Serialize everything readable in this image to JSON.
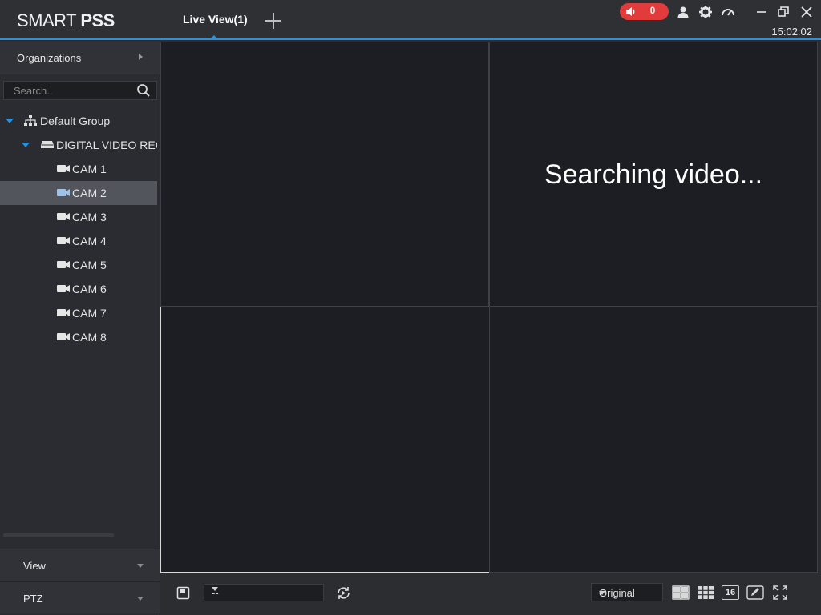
{
  "app": {
    "logo_light": "SMART ",
    "logo_bold": "PSS",
    "tab_label": "Live View(1)",
    "alarm_count": "0",
    "clock": "15:02:02"
  },
  "sidebar": {
    "org_label": "Organizations",
    "search_placeholder": "Search..",
    "group_label": "Default Group",
    "device_label": "DIGITAL VIDEO RECORDER",
    "cameras": [
      "CAM 1",
      "CAM 2",
      "CAM 3",
      "CAM 4",
      "CAM 5",
      "CAM 6",
      "CAM 7",
      "CAM 8"
    ],
    "selected_camera": "CAM 2",
    "view_label": "View",
    "ptz_label": "PTZ"
  },
  "video": {
    "status_text": "Searching video..."
  },
  "toolbar": {
    "view_select_value": "--",
    "ratio_value": "Original",
    "layout16_label": "16"
  },
  "colors": {
    "accent": "#2f8fd8",
    "alarm": "#e23b3b",
    "selected_row": "#52555c"
  }
}
